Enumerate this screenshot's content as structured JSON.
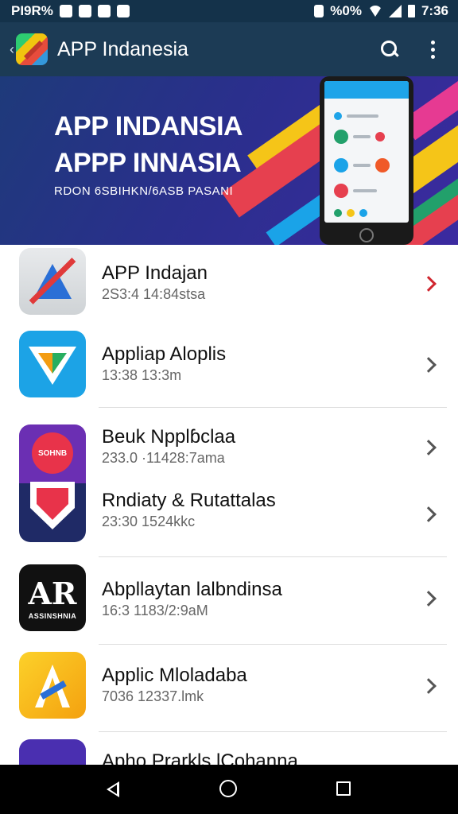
{
  "status_bar": {
    "left_text": "PI9R%",
    "icons_left": [
      "notification-icon",
      "image-icon",
      "gallery-icon",
      "chat-icon"
    ],
    "icons_right": [
      "signal-icon",
      "wifi-icon",
      "cell-icon",
      "battery-icon"
    ],
    "signal_text": "%0%",
    "time": "7:36"
  },
  "app_bar": {
    "title": "APP Indanesia",
    "icons": [
      "back-icon",
      "app-logo",
      "search-icon",
      "more-vert-icon"
    ]
  },
  "banner": {
    "headline_1": "APP INDANSIA",
    "headline_2": "APPP INNASIA",
    "subtext": "RDON 6SBIHKN/6ASB PASANI",
    "colors": [
      "#e6404f",
      "#f5c518",
      "#22a06b",
      "#1aa3e8",
      "#e63a92"
    ]
  },
  "apps": [
    {
      "name": "APP Indajan",
      "meta": "2S3:4  14:84stsa"
    },
    {
      "name": "Appliap Aloplis",
      "meta": "13:38  13:3m"
    },
    {
      "name": "Beuk Npplɓclaa",
      "meta": "233.0 ·11428:7ama"
    },
    {
      "name": "Rndiaty & Rutattalas",
      "meta": "23:30  1524kkc"
    },
    {
      "name": "Abpllaytan lalbndinsa",
      "meta": "16:3  1183/2:9aM"
    },
    {
      "name": "Applic Mloladaba",
      "meta": "7036  12337.lmk"
    },
    {
      "name": "Apho Prarkls lCohanna",
      "meta": ""
    }
  ],
  "icon_text": {
    "balloon": "SOHNB",
    "ab_big": "AR",
    "ab_small": "ASSINSHNIA"
  },
  "nav_bar": {
    "icons": [
      "nav-back-icon",
      "nav-home-icon",
      "nav-recents-icon"
    ]
  }
}
